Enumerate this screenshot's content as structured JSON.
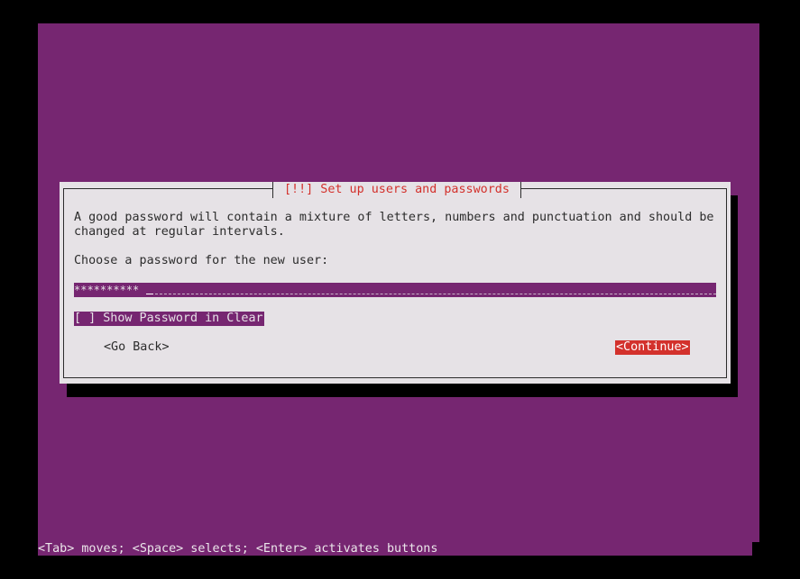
{
  "installer": {
    "dialog": {
      "title": "[!!] Set up users and passwords",
      "description_line1": "A good password will contain a mixture of letters, numbers and punctuation and should be",
      "description_line2": "changed at regular intervals.",
      "prompt": "Choose a password for the new user:",
      "password_field": {
        "value": "**********"
      },
      "show_password_checkbox": {
        "label": "[ ] Show Password in Clear",
        "checked": false
      },
      "buttons": {
        "go_back": "<Go Back>",
        "continue": "<Continue>"
      }
    },
    "status_bar": "<Tab> moves; <Space> selects; <Enter> activates buttons"
  },
  "colors": {
    "background": "#762671",
    "dialog": "#e6e2e6",
    "title_text": "#d3312c",
    "selected_button": "#d3312c",
    "text": "#2c2c2c"
  }
}
